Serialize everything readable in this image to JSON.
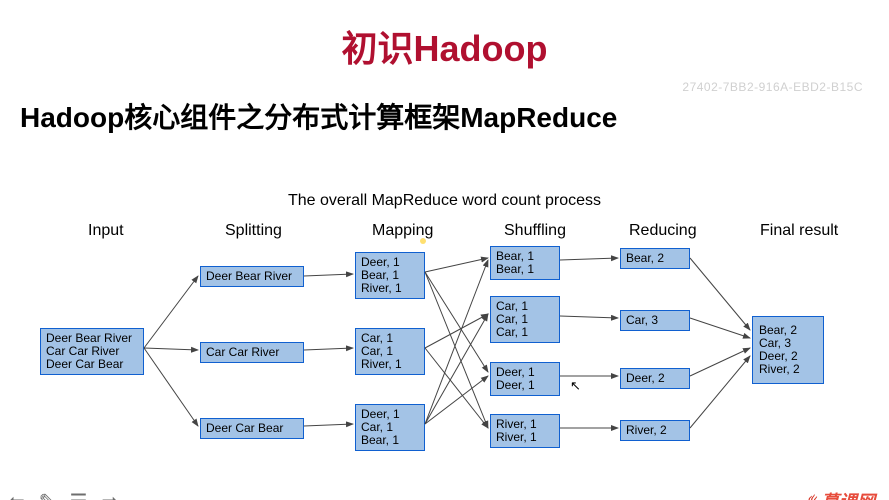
{
  "page": {
    "title": "初识Hadoop",
    "subtitle": "Hadoop核心组件之分布式计算框架MapReduce",
    "watermark": "27402-7BB2-916A-EBD2-B15C",
    "brand": "慕课网"
  },
  "diagram": {
    "caption": "The overall MapReduce word count process",
    "columns": [
      "Input",
      "Splitting",
      "Mapping",
      "Shuffling",
      "Reducing",
      "Final result"
    ],
    "input": "Deer Bear River\nCar Car River\nDeer Car Bear",
    "splitting": [
      "Deer Bear River",
      "Car Car River",
      "Deer Car Bear"
    ],
    "mapping": [
      "Deer, 1\nBear, 1\nRiver, 1",
      "Car, 1\nCar, 1\nRiver, 1",
      "Deer, 1\nCar, 1\nBear, 1"
    ],
    "shuffling": [
      "Bear, 1\nBear, 1",
      "Car, 1\nCar, 1\nCar, 1",
      "Deer, 1\nDeer, 1",
      "River, 1\nRiver, 1"
    ],
    "reducing": [
      "Bear, 2",
      "Car, 3",
      "Deer, 2",
      "River, 2"
    ],
    "final": "Bear, 2\nCar, 3\nDeer, 2\nRiver, 2"
  }
}
